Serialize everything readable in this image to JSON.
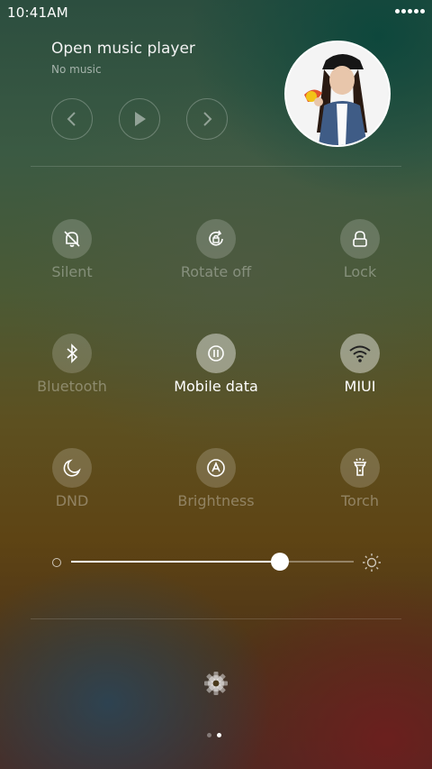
{
  "status_bar": {
    "time": "10:41AM"
  },
  "music": {
    "title": "Open music player",
    "subtitle": "No music",
    "controls": [
      "previous",
      "play",
      "next"
    ]
  },
  "tiles": [
    {
      "label": "Silent",
      "icon": "bell-off-icon",
      "active": false
    },
    {
      "label": "Rotate off",
      "icon": "rotate-lock-icon",
      "active": false
    },
    {
      "label": "Lock",
      "icon": "lock-icon",
      "active": false
    },
    {
      "label": "Bluetooth",
      "icon": "bluetooth-icon",
      "active": false
    },
    {
      "label": "Mobile data",
      "icon": "mobile-data-icon",
      "active": true
    },
    {
      "label": "MIUI",
      "icon": "wifi-icon",
      "active": true
    },
    {
      "label": "DND",
      "icon": "moon-icon",
      "active": false
    },
    {
      "label": "Brightness",
      "icon": "auto-brightness-icon",
      "active": false
    },
    {
      "label": "Torch",
      "icon": "torch-icon",
      "active": false
    }
  ],
  "brightness": {
    "level": 0.74
  },
  "pager": {
    "pages": 2,
    "current": 2
  }
}
